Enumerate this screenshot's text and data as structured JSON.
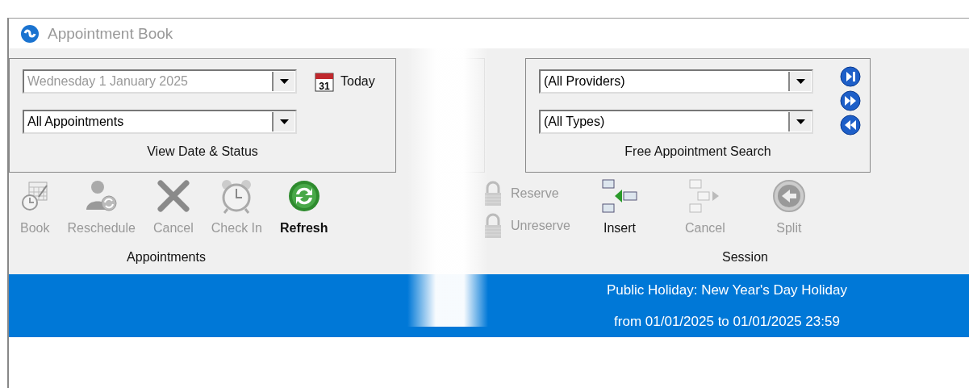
{
  "window": {
    "title": "Appointment Book"
  },
  "view_date_status": {
    "title": "View Date & Status",
    "fields": [
      {
        "value": "Wednesday 1 January 2025",
        "disabled": true
      },
      {
        "value": "All Appointments",
        "disabled": false
      }
    ],
    "today_button": {
      "label": "Today",
      "icon_day": "31"
    }
  },
  "free_search": {
    "title": "Free Appointment Search",
    "fields": [
      {
        "value": "(All Providers)",
        "disabled": false
      },
      {
        "value": "(All Types)",
        "disabled": false
      }
    ]
  },
  "toolbar_groups": [
    {
      "label": "Appointments",
      "buttons": [
        {
          "kind": "large",
          "label": "Book",
          "disabled": true
        },
        {
          "kind": "large",
          "label": "Reschedule",
          "disabled": true
        },
        {
          "kind": "large",
          "label": "Cancel",
          "disabled": true
        },
        {
          "kind": "large",
          "label": "Check In",
          "disabled": true
        },
        {
          "kind": "large",
          "label": "Refresh",
          "disabled": false
        }
      ]
    },
    {
      "buttons": [
        {
          "kind": "small",
          "label": "Reserve",
          "disabled": true
        },
        {
          "kind": "small",
          "label": "Unreserve",
          "disabled": true
        }
      ]
    },
    {
      "label": "Session",
      "buttons": [
        {
          "kind": "large",
          "label": "Insert",
          "disabled": false
        },
        {
          "kind": "large",
          "label": "Cancel",
          "disabled": true
        },
        {
          "kind": "large",
          "label": "Split",
          "disabled": true
        }
      ]
    }
  ],
  "banner": {
    "lines": [
      "Public Holiday: New Year's Day Holiday",
      "from 01/01/2025 to 01/01/2025 23:59"
    ]
  }
}
